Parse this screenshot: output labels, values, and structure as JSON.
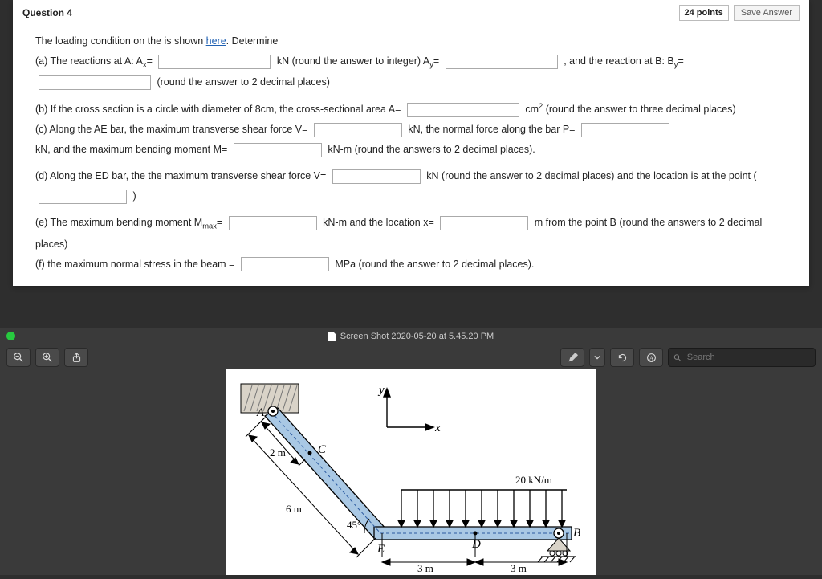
{
  "question": {
    "label": "Question 4",
    "points": "24 points",
    "save": "Save Answer",
    "intro_a": "The loading condition on the is shown ",
    "here": "here",
    "intro_b": ". Determine",
    "a_1": "(a) The reactions at A: A",
    "a_1b": "=",
    "a_2": "kN (round the answer to integer) A",
    "a_2b": "=",
    "a_3": ", and the reaction at B: B",
    "a_3b": "=",
    "a_4": "(round the answer to 2 decimal places)",
    "b_1": "(b) If the cross section is a circle with diameter of 8cm, the cross-sectional area A=",
    "b_2": "cm",
    "b_3": " (round the answer to three decimal places)",
    "c_1": "(c) Along the AE bar, the maximum transverse shear force V=",
    "c_2": "kN, the normal force along the bar P=",
    "c_3": "kN, and the maximum bending moment M=",
    "c_4": "kN-m (round the answers to 2 decimal places).",
    "d_1": "(d) Along the ED bar, the the maximum transverse shear force V=",
    "d_2": "kN (round the answer to 2 decimal places) and the location is at the point (",
    "d_3": ")",
    "e_1": "(e) The maximum bending moment M",
    "e_1b": "=",
    "e_2": "kN-m and the location x=",
    "e_3": "m from the point B (round the answers to 2 decimal places)",
    "f_1": "(f) the maximum normal stress in the beam =",
    "f_2": "MPa (round the answer to 2 decimal places)."
  },
  "viewer": {
    "title": "Screen Shot 2020-05-20 at 5.45.20 PM",
    "search_placeholder": "Search"
  },
  "diagram": {
    "A": "A",
    "B": "B",
    "C": "C",
    "D": "D",
    "E": "E",
    "x": "x",
    "y": "y",
    "len_2m": "2 m",
    "len_6m": "6 m",
    "angle": "45°",
    "load": "20 kN/m",
    "span_3m_a": "3 m",
    "span_3m_b": "3 m"
  }
}
